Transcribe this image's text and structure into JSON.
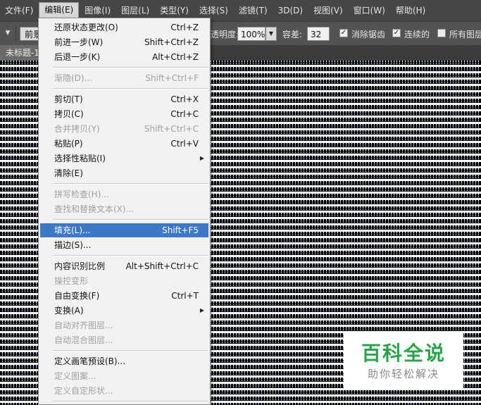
{
  "menubar": {
    "items": [
      {
        "label": "文件(F)"
      },
      {
        "label": "编辑(E)"
      },
      {
        "label": "图像(I)"
      },
      {
        "label": "图层(L)"
      },
      {
        "label": "类型(Y)"
      },
      {
        "label": "选择(S)"
      },
      {
        "label": "滤镜(T)"
      },
      {
        "label": "3D(D)"
      },
      {
        "label": "视图(V)"
      },
      {
        "label": "窗口(W)"
      },
      {
        "label": "帮助(H)"
      }
    ]
  },
  "options": {
    "fill_source": "前景",
    "opacity_label": "透明度:",
    "opacity_value": "100%",
    "tolerance_label": "容差:",
    "tolerance_value": "32",
    "antialias_label": "消除锯齿",
    "contiguous_label": "连续的",
    "all_layers_label": "所有图层"
  },
  "document": {
    "tab_title": "未标题-1"
  },
  "edit_menu": {
    "items": [
      {
        "label": "还原状态更改(O)",
        "shortcut": "Ctrl+Z"
      },
      {
        "label": "前进一步(W)",
        "shortcut": "Shift+Ctrl+Z"
      },
      {
        "label": "后退一步(K)",
        "shortcut": "Alt+Ctrl+Z"
      },
      {
        "label": "渐隐(D)...",
        "shortcut": "Shift+Ctrl+F"
      },
      {
        "label": "剪切(T)",
        "shortcut": "Ctrl+X"
      },
      {
        "label": "拷贝(C)",
        "shortcut": "Ctrl+C"
      },
      {
        "label": "合并拷贝(Y)",
        "shortcut": "Shift+Ctrl+C"
      },
      {
        "label": "粘贴(P)",
        "shortcut": "Ctrl+V"
      },
      {
        "label": "选择性粘贴(I)",
        "shortcut": ""
      },
      {
        "label": "清除(E)",
        "shortcut": ""
      },
      {
        "label": "拼写检查(H)...",
        "shortcut": ""
      },
      {
        "label": "查找和替换文本(X)...",
        "shortcut": ""
      },
      {
        "label": "填充(L)...",
        "shortcut": "Shift+F5"
      },
      {
        "label": "描边(S)...",
        "shortcut": ""
      },
      {
        "label": "内容识别比例",
        "shortcut": "Alt+Shift+Ctrl+C"
      },
      {
        "label": "操控变形",
        "shortcut": ""
      },
      {
        "label": "自由变换(F)",
        "shortcut": "Ctrl+T"
      },
      {
        "label": "变换(A)",
        "shortcut": ""
      },
      {
        "label": "自动对齐图层...",
        "shortcut": ""
      },
      {
        "label": "自动混合图层...",
        "shortcut": ""
      },
      {
        "label": "定义画笔预设(B)...",
        "shortcut": ""
      },
      {
        "label": "定义图案...",
        "shortcut": ""
      },
      {
        "label": "定义自定形状...",
        "shortcut": ""
      }
    ]
  },
  "watermark": {
    "title": "百科全说",
    "subtitle": "助你轻松解决"
  }
}
